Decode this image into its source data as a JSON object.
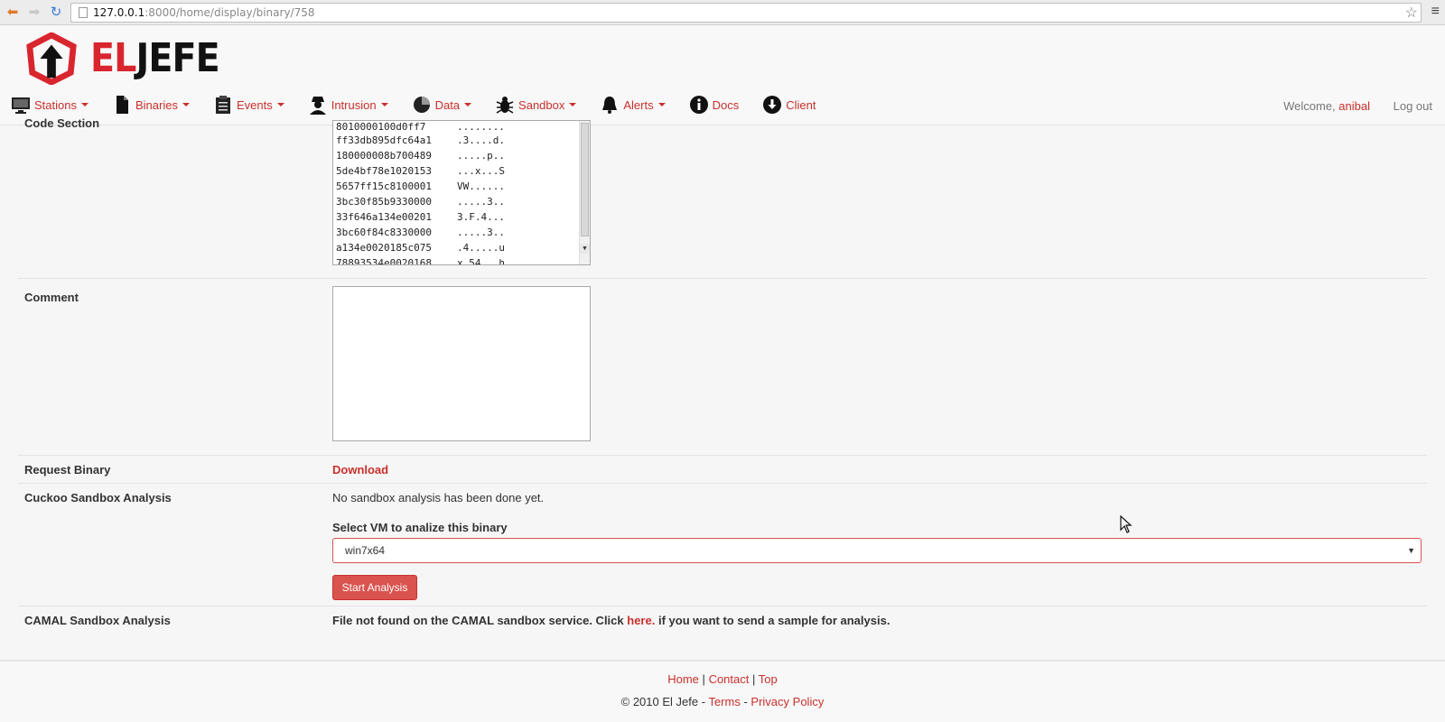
{
  "browser": {
    "url_host": "127.0.0.1",
    "url_path": ":8000/home/display/binary/758"
  },
  "header": {
    "logo_el": "EL",
    "logo_jefe": "JEFE",
    "nav": {
      "stations": "Stations",
      "binaries": "Binaries",
      "events": "Events",
      "intrusion": "Intrusion",
      "data": "Data",
      "sandbox": "Sandbox",
      "alerts": "Alerts",
      "docs": "Docs",
      "client": "Client"
    },
    "welcome": "Welcome,",
    "username": "anibal",
    "logout": "Log out"
  },
  "code_section": {
    "label": "Code Section",
    "lines": [
      {
        "addr": "8010000100d0ff7",
        "ascii": "........"
      },
      {
        "addr": "ff33db895dfc64a1",
        "ascii": ".3....d."
      },
      {
        "addr": "180000008b700489",
        "ascii": ".....p.."
      },
      {
        "addr": "5de4bf78e1020153",
        "ascii": "...x...S"
      },
      {
        "addr": "5657ff15c8100001",
        "ascii": "VW......"
      },
      {
        "addr": "3bc30f85b9330000",
        "ascii": ".....3.."
      },
      {
        "addr": "33f646a134e00201",
        "ascii": "3.F.4..."
      },
      {
        "addr": "3bc60f84c8330000",
        "ascii": ".....3.."
      },
      {
        "addr": "a134e0020185c075",
        "ascii": ".4.....u"
      },
      {
        "addr": "78893534e0020168",
        "ascii": "x.54...h"
      }
    ]
  },
  "comment": {
    "label": "Comment",
    "value": ""
  },
  "request_binary": {
    "label": "Request Binary",
    "link": "Download"
  },
  "cuckoo": {
    "label": "Cuckoo Sandbox Analysis",
    "status": "No sandbox analysis has been done yet.",
    "vm_label": "Select VM to analize this binary",
    "vm_selected": "win7x64",
    "start_button": "Start Analysis"
  },
  "camal": {
    "label": "CAMAL Sandbox Analysis",
    "text_before": "File not found on the CAMAL sandbox service. Click",
    "link": "here.",
    "text_after": "if you want to send a sample for analysis."
  },
  "footer": {
    "home": "Home",
    "contact": "Contact",
    "top": "Top",
    "sep": "|",
    "copyright": "© 2010 El Jefe -",
    "terms": "Terms",
    "dash": "-",
    "privacy": "Privacy Policy"
  },
  "colors": {
    "accent": "#c9302c",
    "button": "#d9534f",
    "logo_red": "#d9262e"
  }
}
